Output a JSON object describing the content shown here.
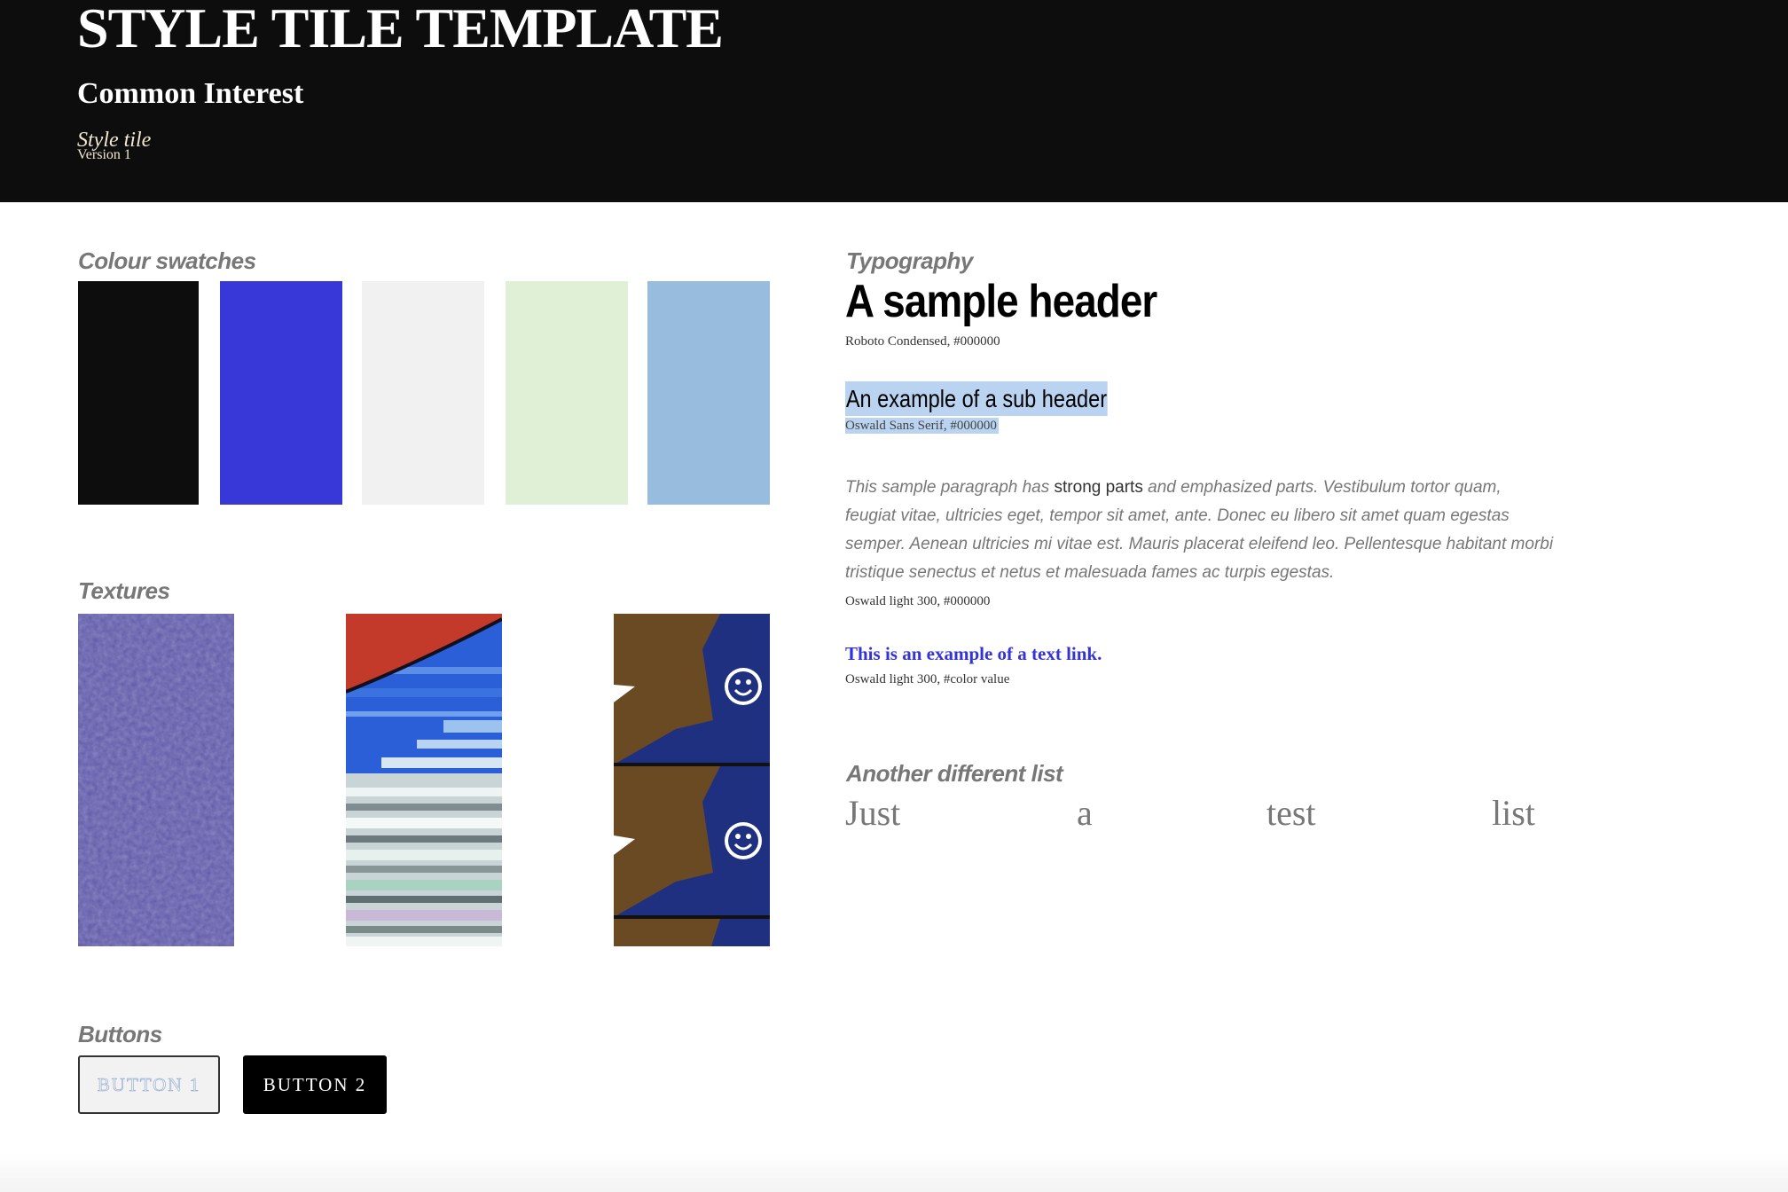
{
  "header": {
    "title": "STYLE TILE TEMPLATE",
    "subtitle": "Common Interest",
    "tile_label": "Style tile",
    "version": "Version 1"
  },
  "swatches": {
    "title": "Colour swatches",
    "colors": [
      "#0d0d0d",
      "#3838d8",
      "#f1f1f1",
      "#dff0d6",
      "#97bcde"
    ]
  },
  "textures": {
    "title": "Textures"
  },
  "buttons": {
    "title": "Buttons",
    "button1": "BUTTON 1",
    "button2": "BUTTON 2"
  },
  "typography": {
    "title": "Typography",
    "header_sample": "A sample header",
    "header_note": "Roboto Condensed, #000000",
    "subheader_sample": "An example of a sub header",
    "subheader_note": "Oswald Sans Serif, #000000",
    "paragraph_before": "This sample paragraph has ",
    "paragraph_strong": "strong parts",
    "paragraph_after": " and emphasized parts. Vestibulum tortor quam, feugiat vitae, ultricies eget, tempor sit amet, ante. Donec eu libero sit amet quam egestas semper. Aenean ultricies mi vitae est. Mauris placerat eleifend leo. Pellentesque habitant morbi tristique senectus et netus et malesuada fames ac turpis egestas.",
    "paragraph_note": "Oswald light 300, #000000",
    "link_text": "This is an example of a text link.",
    "link_note": "Oswald light 300, #color value"
  },
  "list": {
    "title": "Another different list",
    "items": [
      "Just",
      "a",
      "test",
      "list"
    ]
  }
}
